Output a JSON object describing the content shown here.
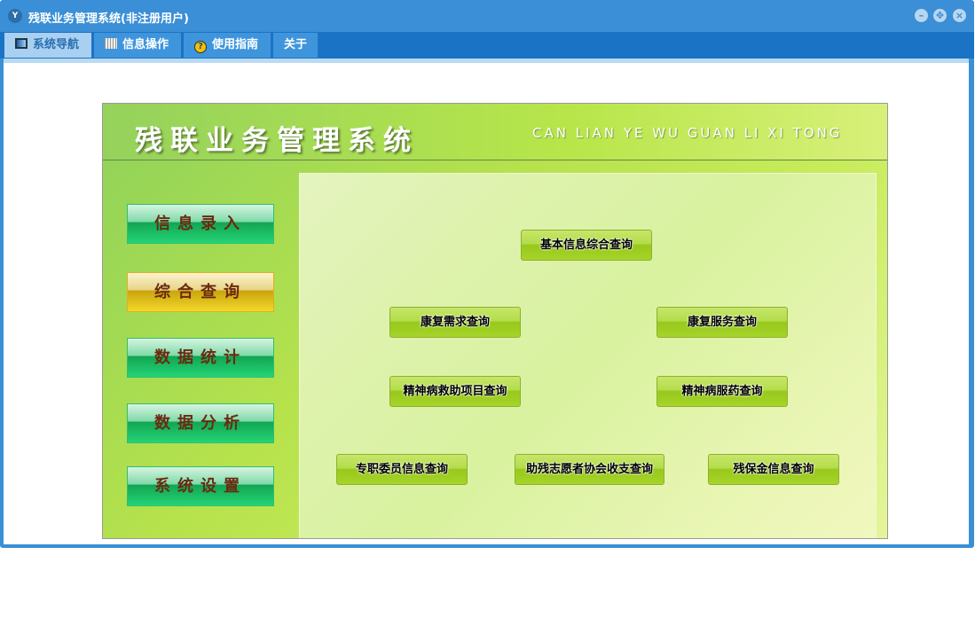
{
  "window": {
    "title": "残联业务管理系统(非注册用户)",
    "logo": "YF"
  },
  "tabs": [
    {
      "label": "系统导航",
      "icon": "monitor-icon"
    },
    {
      "label": "信息操作",
      "icon": "grid-icon"
    },
    {
      "label": "使用指南",
      "icon": "help-icon"
    },
    {
      "label": "关于"
    }
  ],
  "banner": {
    "title": "残联业务管理系统",
    "subtitle": "CAN LIAN YE WU GUAN LI XI TONG"
  },
  "nav": [
    "信息录入",
    "综合查询",
    "数据统计",
    "数据分析",
    "系统设置"
  ],
  "queries": [
    "基本信息综合查询",
    "康复需求查询",
    "康复服务查询",
    "精神病救助项目查询",
    "精神病服药查询",
    "专职委员信息查询",
    "助残志愿者协会收支查询",
    "残保金信息查询"
  ]
}
